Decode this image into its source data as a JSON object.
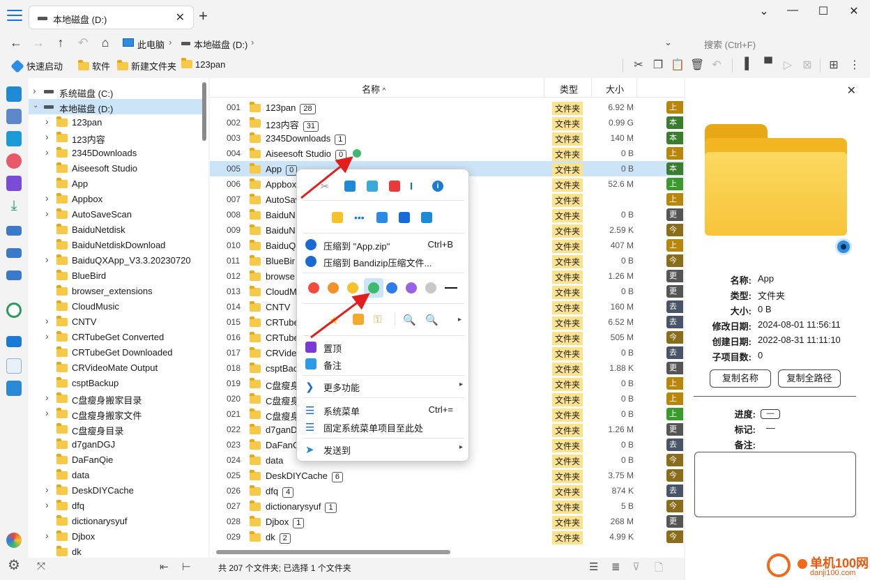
{
  "tab": {
    "title": "本地磁盘 (D:)"
  },
  "breadcrumb": {
    "pc": "此电脑",
    "drive": "本地磁盘 (D:)"
  },
  "search": {
    "placeholder": "搜索 (Ctrl+F)"
  },
  "quickbar": [
    "快速启动",
    "软件",
    "新建文件夹",
    "123pan"
  ],
  "tree": [
    {
      "label": "系统磁盘 (C:)",
      "type": "drive",
      "expand": "collapsed",
      "level": 0
    },
    {
      "label": "本地磁盘 (D:)",
      "type": "drive",
      "expand": "expanded",
      "level": 0
    },
    {
      "label": "123pan",
      "expand": "collapsed",
      "level": 1
    },
    {
      "label": "123内容",
      "expand": "collapsed",
      "level": 1
    },
    {
      "label": "2345Downloads",
      "expand": "collapsed",
      "level": 1
    },
    {
      "label": "Aiseesoft Studio",
      "expand": "none",
      "level": 1
    },
    {
      "label": "App",
      "expand": "none",
      "level": 1
    },
    {
      "label": "Appbox",
      "expand": "collapsed",
      "level": 1
    },
    {
      "label": "AutoSaveScan",
      "expand": "collapsed",
      "level": 1
    },
    {
      "label": "BaiduNetdisk",
      "expand": "none",
      "level": 1
    },
    {
      "label": "BaiduNetdiskDownload",
      "expand": "none",
      "level": 1
    },
    {
      "label": "BaiduQXApp_V3.3.20230720",
      "expand": "collapsed",
      "level": 1
    },
    {
      "label": "BlueBird",
      "expand": "none",
      "level": 1
    },
    {
      "label": "browser_extensions",
      "expand": "none",
      "level": 1
    },
    {
      "label": "CloudMusic",
      "expand": "none",
      "level": 1
    },
    {
      "label": "CNTV",
      "expand": "collapsed",
      "level": 1
    },
    {
      "label": "CRTubeGet Converted",
      "expand": "collapsed",
      "level": 1
    },
    {
      "label": "CRTubeGet Downloaded",
      "expand": "none",
      "level": 1
    },
    {
      "label": "CRVideoMate Output",
      "expand": "none",
      "level": 1
    },
    {
      "label": "csptBackup",
      "expand": "none",
      "level": 1
    },
    {
      "label": "C盘瘦身搬家目录",
      "expand": "collapsed",
      "level": 1
    },
    {
      "label": "C盘瘦身搬家文件",
      "expand": "collapsed",
      "level": 1
    },
    {
      "label": "C盘瘦身目录",
      "expand": "none",
      "level": 1
    },
    {
      "label": "d7ganDGJ",
      "expand": "none",
      "level": 1
    },
    {
      "label": "DaFanQie",
      "expand": "none",
      "level": 1
    },
    {
      "label": "data",
      "expand": "none",
      "level": 1
    },
    {
      "label": "DeskDIYCache",
      "expand": "collapsed",
      "level": 1
    },
    {
      "label": "dfq",
      "expand": "collapsed",
      "level": 1
    },
    {
      "label": "dictionarysyuf",
      "expand": "none",
      "level": 1
    },
    {
      "label": "Djbox",
      "expand": "collapsed",
      "level": 1
    },
    {
      "label": "dk",
      "expand": "none",
      "level": 1
    }
  ],
  "columns": {
    "name": "名称",
    "type": "类型",
    "size": "大小"
  },
  "files": [
    {
      "num": "001",
      "name": "123pan",
      "count": "28",
      "type": "文件夹",
      "size": "6.92 M",
      "tag": "上",
      "tagColor": "#b8860b"
    },
    {
      "num": "002",
      "name": "123内容",
      "count": "31",
      "type": "文件夹",
      "size": "0.99 G",
      "tag": "本",
      "tagColor": "#3a7d2c"
    },
    {
      "num": "003",
      "name": "2345Downloads",
      "count": "1",
      "type": "文件夹",
      "size": "140 M",
      "tag": "本",
      "tagColor": "#3a7d2c"
    },
    {
      "num": "004",
      "name": "Aiseesoft Studio",
      "count": "0",
      "type": "文件夹",
      "size": "0 B",
      "tag": "上",
      "tagColor": "#b8860b",
      "dot": true
    },
    {
      "num": "005",
      "name": "App",
      "count": "0",
      "type": "文件夹",
      "size": "0 B",
      "tag": "本",
      "tagColor": "#3a7d2c",
      "selected": true
    },
    {
      "num": "006",
      "name": "Appbox",
      "count": "",
      "type": "文件夹",
      "size": "52.6 M",
      "tag": "上",
      "tagColor": "#3a9a2c"
    },
    {
      "num": "007",
      "name": "AutoSav",
      "count": "",
      "type": "文件夹",
      "size": "",
      "tag": "上",
      "tagColor": "#b8860b"
    },
    {
      "num": "008",
      "name": "BaiduN",
      "count": "",
      "type": "文件夹",
      "size": "0 B",
      "tag": "更早",
      "tagColor": "#555555"
    },
    {
      "num": "009",
      "name": "BaiduN",
      "count": "",
      "type": "文件夹",
      "size": "2.59 K",
      "tag": "今",
      "tagColor": "#8a6d1a"
    },
    {
      "num": "010",
      "name": "BaiduQ",
      "count": "",
      "type": "文件夹",
      "size": "407 M",
      "tag": "上",
      "tagColor": "#b8860b"
    },
    {
      "num": "011",
      "name": "BlueBir",
      "count": "",
      "type": "文件夹",
      "size": "0 B",
      "tag": "今",
      "tagColor": "#8a6d1a"
    },
    {
      "num": "012",
      "name": "browse",
      "count": "",
      "type": "文件夹",
      "size": "1.26 M",
      "tag": "更早",
      "tagColor": "#555555"
    },
    {
      "num": "013",
      "name": "CloudM",
      "count": "",
      "type": "文件夹",
      "size": "0 B",
      "tag": "更早",
      "tagColor": "#555555"
    },
    {
      "num": "014",
      "name": "CNTV",
      "count": "",
      "type": "文件夹",
      "size": "160 M",
      "tag": "去",
      "tagColor": "#4a5468"
    },
    {
      "num": "015",
      "name": "CRTube",
      "count": "",
      "type": "文件夹",
      "size": "6.52 M",
      "tag": "去",
      "tagColor": "#4a5468"
    },
    {
      "num": "016",
      "name": "CRTube",
      "count": "",
      "type": "文件夹",
      "size": "505 M",
      "tag": "今",
      "tagColor": "#8a6d1a"
    },
    {
      "num": "017",
      "name": "CRVide",
      "count": "",
      "type": "文件夹",
      "size": "0 B",
      "tag": "去",
      "tagColor": "#4a5468"
    },
    {
      "num": "018",
      "name": "csptBac",
      "count": "",
      "type": "文件夹",
      "size": "1.88 K",
      "tag": "更早",
      "tagColor": "#555555"
    },
    {
      "num": "019",
      "name": "C盘瘦身",
      "count": "",
      "type": "文件夹",
      "size": "0 B",
      "tag": "上",
      "tagColor": "#b8860b"
    },
    {
      "num": "020",
      "name": "C盘瘦身",
      "count": "",
      "type": "文件夹",
      "size": "0 B",
      "tag": "上",
      "tagColor": "#b8860b"
    },
    {
      "num": "021",
      "name": "C盘瘦身",
      "count": "",
      "type": "文件夹",
      "size": "0 B",
      "tag": "上",
      "tagColor": "#3a9a2c"
    },
    {
      "num": "022",
      "name": "d7ganD",
      "count": "",
      "type": "文件夹",
      "size": "1.26 M",
      "tag": "更早",
      "tagColor": "#555555"
    },
    {
      "num": "023",
      "name": "DaFanQ",
      "count": "",
      "type": "文件夹",
      "size": "0 B",
      "tag": "去",
      "tagColor": "#4a5468"
    },
    {
      "num": "024",
      "name": "data",
      "count": "",
      "type": "文件夹",
      "size": "0 B",
      "tag": "今",
      "tagColor": "#8a6d1a"
    },
    {
      "num": "025",
      "name": "DeskDIYCache",
      "count": "6",
      "type": "文件夹",
      "size": "3.75 M",
      "tag": "今",
      "tagColor": "#8a6d1a"
    },
    {
      "num": "026",
      "name": "dfq",
      "count": "4",
      "type": "文件夹",
      "size": "874 K",
      "tag": "去",
      "tagColor": "#4a5468"
    },
    {
      "num": "027",
      "name": "dictionarysyuf",
      "count": "1",
      "type": "文件夹",
      "size": "5 B",
      "tag": "今",
      "tagColor": "#8a6d1a"
    },
    {
      "num": "028",
      "name": "Djbox",
      "count": "1",
      "type": "文件夹",
      "size": "268 M",
      "tag": "更早",
      "tagColor": "#555555"
    },
    {
      "num": "029",
      "name": "dk",
      "count": "2",
      "type": "文件夹",
      "size": "4.99 K",
      "tag": "今",
      "tagColor": "#8a6d1a"
    }
  ],
  "status": "共 207 个文件夹; 已选择 1 个文件夹",
  "menu": {
    "zip1": "压缩到 \"App.zip\"",
    "zip1_sc": "Ctrl+B",
    "zip2": "压缩到 Bandizip压缩文件...",
    "pin_top": "置顶",
    "note": "备注",
    "more": "更多功能",
    "sysmenu": "系统菜单",
    "sysmenu_sc": "Ctrl+=",
    "pin_sys": "固定系统菜单项目至此处",
    "sendto": "发送到",
    "colors": [
      "#f04b3c",
      "#f5912a",
      "#f5c22e",
      "#3dba6d",
      "#2d7ce8",
      "#9a63e6",
      "#c8c8c8"
    ]
  },
  "panel": {
    "props": [
      {
        "k": "名称:",
        "v": "App"
      },
      {
        "k": "类型:",
        "v": "文件夹"
      },
      {
        "k": "大小:",
        "v": "0 B"
      },
      {
        "k": "修改日期:",
        "v": "2024-08-01  11:56:11"
      },
      {
        "k": "创建日期:",
        "v": "2022-08-31  11:11:10"
      },
      {
        "k": "子项目数:",
        "v": "0"
      }
    ],
    "copy_name": "复制名称",
    "copy_path": "复制全路径",
    "progress_k": "进度:",
    "progress_v": "—",
    "mark_k": "标记:",
    "mark_v": "—",
    "note_k": "备注:"
  },
  "watermark": {
    "t1": "单机100网",
    "t2": "danji100.com"
  }
}
